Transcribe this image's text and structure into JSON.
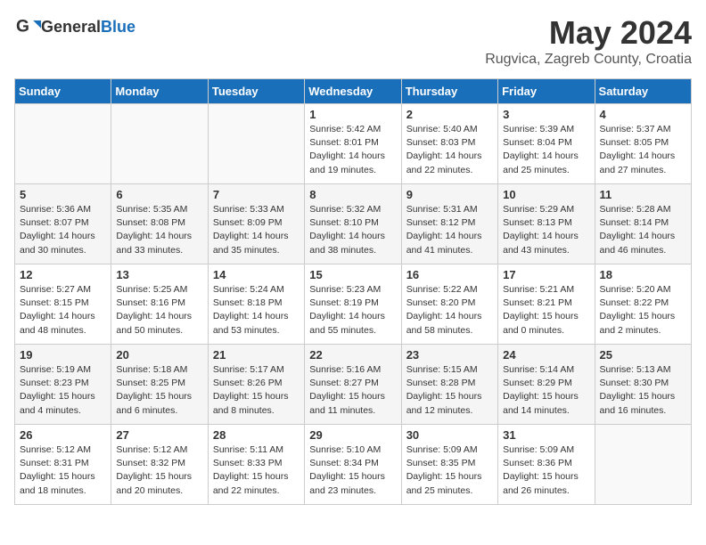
{
  "header": {
    "logo_general": "General",
    "logo_blue": "Blue",
    "month_year": "May 2024",
    "location": "Rugvica, Zagreb County, Croatia"
  },
  "days_of_week": [
    "Sunday",
    "Monday",
    "Tuesday",
    "Wednesday",
    "Thursday",
    "Friday",
    "Saturday"
  ],
  "weeks": [
    [
      {
        "day": "",
        "info": ""
      },
      {
        "day": "",
        "info": ""
      },
      {
        "day": "",
        "info": ""
      },
      {
        "day": "1",
        "info": "Sunrise: 5:42 AM\nSunset: 8:01 PM\nDaylight: 14 hours\nand 19 minutes."
      },
      {
        "day": "2",
        "info": "Sunrise: 5:40 AM\nSunset: 8:03 PM\nDaylight: 14 hours\nand 22 minutes."
      },
      {
        "day": "3",
        "info": "Sunrise: 5:39 AM\nSunset: 8:04 PM\nDaylight: 14 hours\nand 25 minutes."
      },
      {
        "day": "4",
        "info": "Sunrise: 5:37 AM\nSunset: 8:05 PM\nDaylight: 14 hours\nand 27 minutes."
      }
    ],
    [
      {
        "day": "5",
        "info": "Sunrise: 5:36 AM\nSunset: 8:07 PM\nDaylight: 14 hours\nand 30 minutes."
      },
      {
        "day": "6",
        "info": "Sunrise: 5:35 AM\nSunset: 8:08 PM\nDaylight: 14 hours\nand 33 minutes."
      },
      {
        "day": "7",
        "info": "Sunrise: 5:33 AM\nSunset: 8:09 PM\nDaylight: 14 hours\nand 35 minutes."
      },
      {
        "day": "8",
        "info": "Sunrise: 5:32 AM\nSunset: 8:10 PM\nDaylight: 14 hours\nand 38 minutes."
      },
      {
        "day": "9",
        "info": "Sunrise: 5:31 AM\nSunset: 8:12 PM\nDaylight: 14 hours\nand 41 minutes."
      },
      {
        "day": "10",
        "info": "Sunrise: 5:29 AM\nSunset: 8:13 PM\nDaylight: 14 hours\nand 43 minutes."
      },
      {
        "day": "11",
        "info": "Sunrise: 5:28 AM\nSunset: 8:14 PM\nDaylight: 14 hours\nand 46 minutes."
      }
    ],
    [
      {
        "day": "12",
        "info": "Sunrise: 5:27 AM\nSunset: 8:15 PM\nDaylight: 14 hours\nand 48 minutes."
      },
      {
        "day": "13",
        "info": "Sunrise: 5:25 AM\nSunset: 8:16 PM\nDaylight: 14 hours\nand 50 minutes."
      },
      {
        "day": "14",
        "info": "Sunrise: 5:24 AM\nSunset: 8:18 PM\nDaylight: 14 hours\nand 53 minutes."
      },
      {
        "day": "15",
        "info": "Sunrise: 5:23 AM\nSunset: 8:19 PM\nDaylight: 14 hours\nand 55 minutes."
      },
      {
        "day": "16",
        "info": "Sunrise: 5:22 AM\nSunset: 8:20 PM\nDaylight: 14 hours\nand 58 minutes."
      },
      {
        "day": "17",
        "info": "Sunrise: 5:21 AM\nSunset: 8:21 PM\nDaylight: 15 hours\nand 0 minutes."
      },
      {
        "day": "18",
        "info": "Sunrise: 5:20 AM\nSunset: 8:22 PM\nDaylight: 15 hours\nand 2 minutes."
      }
    ],
    [
      {
        "day": "19",
        "info": "Sunrise: 5:19 AM\nSunset: 8:23 PM\nDaylight: 15 hours\nand 4 minutes."
      },
      {
        "day": "20",
        "info": "Sunrise: 5:18 AM\nSunset: 8:25 PM\nDaylight: 15 hours\nand 6 minutes."
      },
      {
        "day": "21",
        "info": "Sunrise: 5:17 AM\nSunset: 8:26 PM\nDaylight: 15 hours\nand 8 minutes."
      },
      {
        "day": "22",
        "info": "Sunrise: 5:16 AM\nSunset: 8:27 PM\nDaylight: 15 hours\nand 11 minutes."
      },
      {
        "day": "23",
        "info": "Sunrise: 5:15 AM\nSunset: 8:28 PM\nDaylight: 15 hours\nand 12 minutes."
      },
      {
        "day": "24",
        "info": "Sunrise: 5:14 AM\nSunset: 8:29 PM\nDaylight: 15 hours\nand 14 minutes."
      },
      {
        "day": "25",
        "info": "Sunrise: 5:13 AM\nSunset: 8:30 PM\nDaylight: 15 hours\nand 16 minutes."
      }
    ],
    [
      {
        "day": "26",
        "info": "Sunrise: 5:12 AM\nSunset: 8:31 PM\nDaylight: 15 hours\nand 18 minutes."
      },
      {
        "day": "27",
        "info": "Sunrise: 5:12 AM\nSunset: 8:32 PM\nDaylight: 15 hours\nand 20 minutes."
      },
      {
        "day": "28",
        "info": "Sunrise: 5:11 AM\nSunset: 8:33 PM\nDaylight: 15 hours\nand 22 minutes."
      },
      {
        "day": "29",
        "info": "Sunrise: 5:10 AM\nSunset: 8:34 PM\nDaylight: 15 hours\nand 23 minutes."
      },
      {
        "day": "30",
        "info": "Sunrise: 5:09 AM\nSunset: 8:35 PM\nDaylight: 15 hours\nand 25 minutes."
      },
      {
        "day": "31",
        "info": "Sunrise: 5:09 AM\nSunset: 8:36 PM\nDaylight: 15 hours\nand 26 minutes."
      },
      {
        "day": "",
        "info": ""
      }
    ]
  ]
}
